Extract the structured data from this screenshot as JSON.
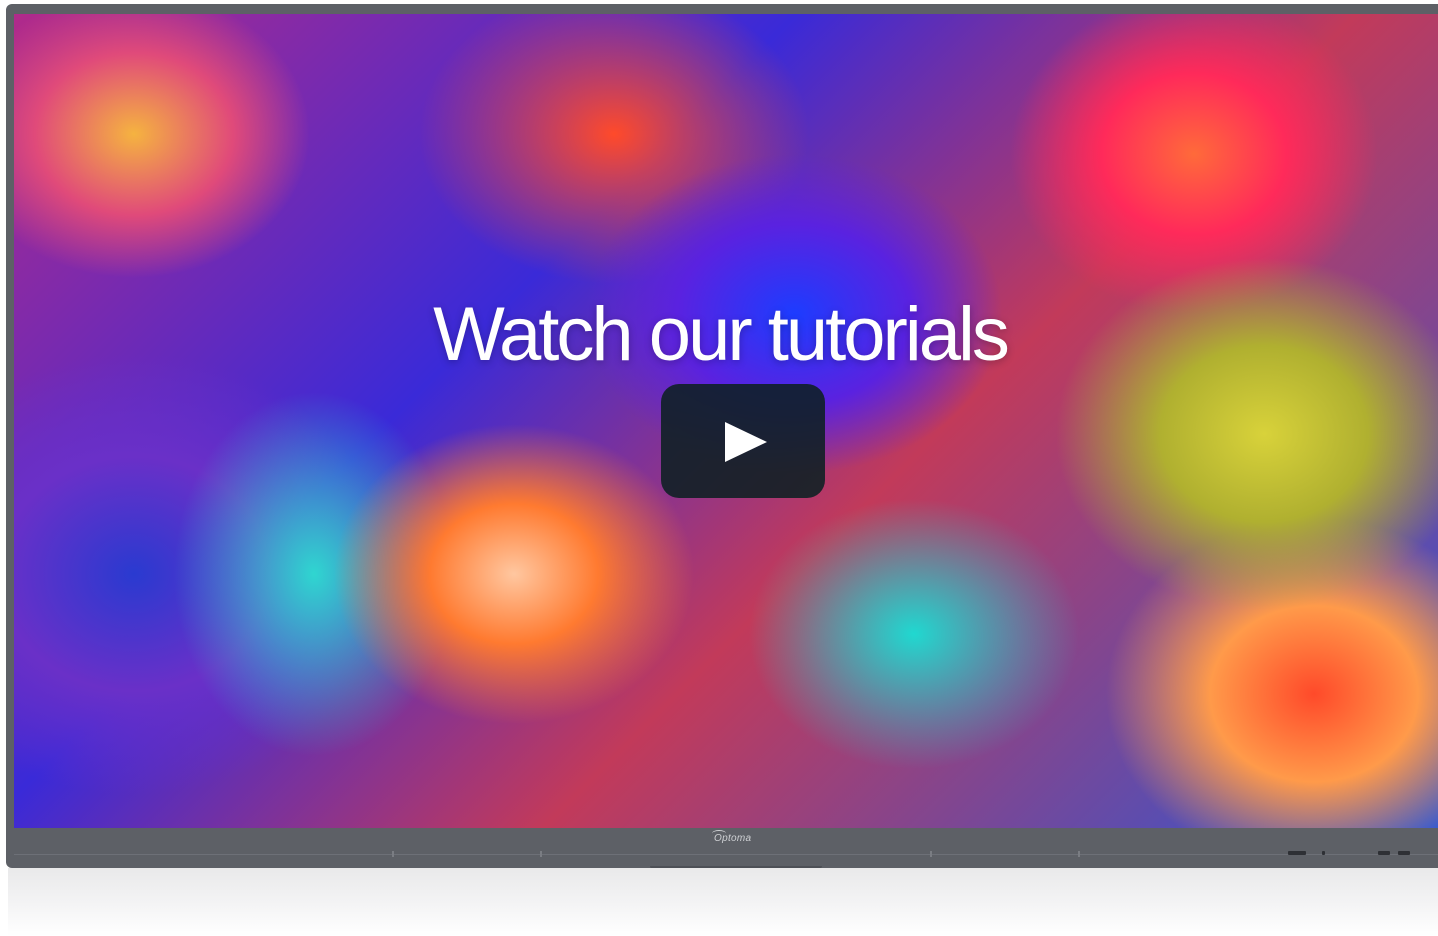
{
  "video": {
    "title": "Watch our tutorials",
    "play_icon": "play-icon",
    "play_color": "#ffffff",
    "play_bg": "#0c2022"
  },
  "device": {
    "brand_logo": "Optoma",
    "bezel_color": "#5d6066"
  }
}
